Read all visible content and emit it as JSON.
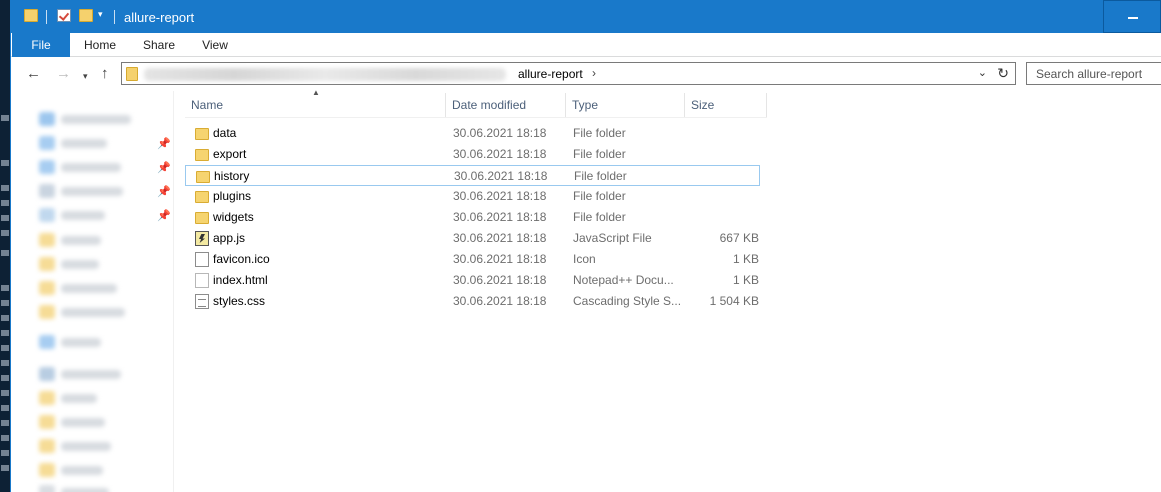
{
  "window": {
    "title": "allure-report",
    "accent": "#1979ca"
  },
  "ribbon": {
    "tabs": [
      "File",
      "Home",
      "Share",
      "View"
    ]
  },
  "address": {
    "crumb": "allure-report",
    "path_hidden": true
  },
  "search": {
    "placeholder": "Search allure-report"
  },
  "columns": {
    "name": "Name",
    "date": "Date modified",
    "type": "Type",
    "size": "Size"
  },
  "files": [
    {
      "name": "data",
      "date": "30.06.2021 18:18",
      "type": "File folder",
      "size": "",
      "icon": "folder-icon"
    },
    {
      "name": "export",
      "date": "30.06.2021 18:18",
      "type": "File folder",
      "size": "",
      "icon": "folder-icon"
    },
    {
      "name": "history",
      "date": "30.06.2021 18:18",
      "type": "File folder",
      "size": "",
      "icon": "folder-icon"
    },
    {
      "name": "plugins",
      "date": "30.06.2021 18:18",
      "type": "File folder",
      "size": "",
      "icon": "folder-icon"
    },
    {
      "name": "widgets",
      "date": "30.06.2021 18:18",
      "type": "File folder",
      "size": "",
      "icon": "folder-icon"
    },
    {
      "name": "app.js",
      "date": "30.06.2021 18:18",
      "type": "JavaScript File",
      "size": "667 KB",
      "icon": "javascript-file-icon"
    },
    {
      "name": "favicon.ico",
      "date": "30.06.2021 18:18",
      "type": "Icon",
      "size": "1 KB",
      "icon": "icon-file-icon"
    },
    {
      "name": "index.html",
      "date": "30.06.2021 18:18",
      "type": "Notepad++ Docu...",
      "size": "1 KB",
      "icon": "html-file-icon"
    },
    {
      "name": "styles.css",
      "date": "30.06.2021 18:18",
      "type": "Cascading Style S...",
      "size": "1 504 KB",
      "icon": "css-file-icon"
    }
  ]
}
